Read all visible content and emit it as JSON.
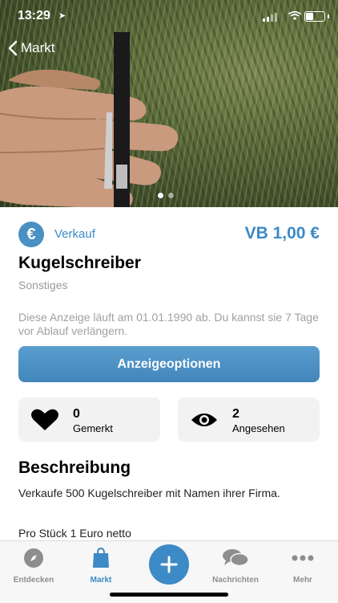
{
  "status_bar": {
    "time": "13:29"
  },
  "nav": {
    "back_label": "Markt"
  },
  "listing": {
    "type_label": "Verkauf",
    "price": "VB 1,00 €",
    "title": "Kugelschreiber",
    "category": "Sonstiges",
    "notice": "Diese Anzeige läuft am 01.01.1990 ab. Du kannst sie 7 Tage vor Ablauf verlängern.",
    "options_button": "Anzeigeoptionen",
    "stats": {
      "saved_count": "0",
      "saved_label": "Gemerkt",
      "views_count": "2",
      "views_label": "Angesehen"
    },
    "description_heading": "Beschreibung",
    "description_line1": "Verkaufe 500 Kugelschreiber mit Namen ihrer Firma.",
    "description_line2": "Pro Stück 1 Euro netto"
  },
  "tabbar": {
    "items": [
      {
        "label": "Entdecken",
        "icon": "compass-icon"
      },
      {
        "label": "Markt",
        "icon": "shopping-bag-icon"
      },
      {
        "label": "",
        "icon": "plus-icon"
      },
      {
        "label": "Nachrichten",
        "icon": "chat-bubbles-icon"
      },
      {
        "label": "Mehr",
        "icon": "more-icon"
      }
    ]
  },
  "colors": {
    "accent": "#3c8ac6",
    "button": "#4a90c2",
    "card": "#f2f2f2"
  }
}
